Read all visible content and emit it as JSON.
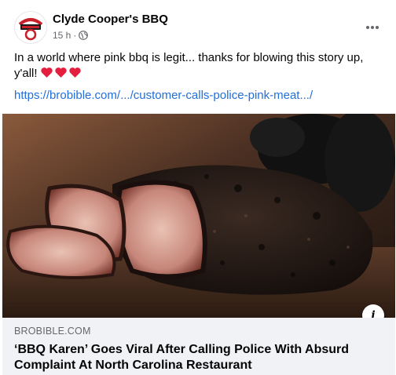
{
  "post": {
    "page_name": "Clyde Cooper's BBQ",
    "time": "15 h",
    "separator": "·",
    "text": "In a world where pink bbq is legit... thanks for blowing this story up, y'all!",
    "link": "https://brobible.com/.../customer-calls-police-pink-meat.../",
    "icons": {
      "avatar": "clyde-coopers-logo",
      "audience": "globe-icon",
      "menu": "more-options-icon",
      "reaction": "heart-emoji",
      "info": "info-icon"
    }
  },
  "link_preview": {
    "image_subject": "sliced smoked brisket with pink smoke ring held by black-gloved hands",
    "domain": "BROBIBLE.COM",
    "headline": "‘BBQ Karen’ Goes Viral After Calling Police With Absurd Complaint At North Carolina Restaurant"
  },
  "colors": {
    "text": "#050505",
    "secondary": "#65676b",
    "link": "#216fdb",
    "caption_bg": "#f0f2f5",
    "heart": "#e41e3f"
  }
}
